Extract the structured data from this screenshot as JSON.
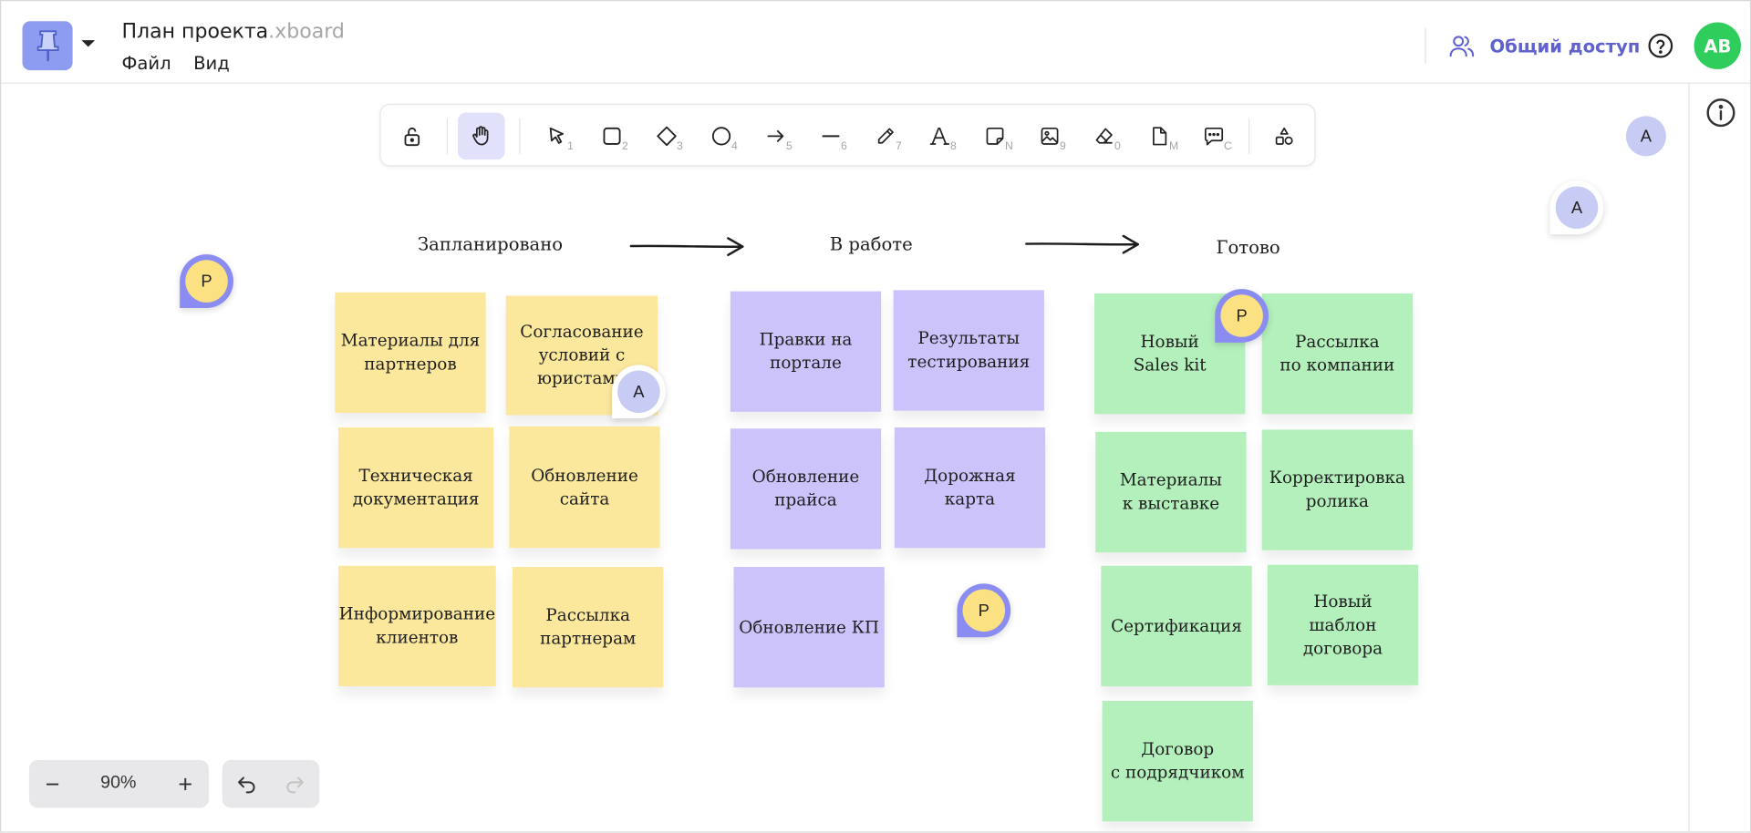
{
  "header": {
    "title": "План проекта",
    "title_ext": ".xboard",
    "menu": [
      "Файл",
      "Вид"
    ],
    "share_label": "Общий доступ",
    "user_initials": "AB",
    "accent_color": "#5f61cf",
    "avatar_color": "#2fce5c"
  },
  "toolbar": {
    "tools": [
      {
        "name": "lock",
        "hotkey": ""
      },
      {
        "name": "hand",
        "hotkey": "",
        "active": true
      },
      {
        "name": "select",
        "hotkey": "1"
      },
      {
        "name": "rectangle",
        "hotkey": "2"
      },
      {
        "name": "diamond",
        "hotkey": "3"
      },
      {
        "name": "ellipse",
        "hotkey": "4"
      },
      {
        "name": "arrow",
        "hotkey": "5"
      },
      {
        "name": "line",
        "hotkey": "6"
      },
      {
        "name": "pencil",
        "hotkey": "7"
      },
      {
        "name": "text",
        "hotkey": "8"
      },
      {
        "name": "sticky-note",
        "hotkey": "N"
      },
      {
        "name": "image",
        "hotkey": "9"
      },
      {
        "name": "eraser",
        "hotkey": "0"
      },
      {
        "name": "document",
        "hotkey": "M"
      },
      {
        "name": "comment",
        "hotkey": "C"
      },
      {
        "name": "shapes-library",
        "hotkey": ""
      }
    ]
  },
  "board": {
    "columns": [
      {
        "title": "Запланировано",
        "color": "#fbe89d",
        "notes": [
          "Материалы для\nпартнеров",
          "Согласование\nусловий с\nюристами",
          "Техническая\nдокументация",
          "Обновление\nсайта",
          "Информирование\nклиентов",
          "Рассылка\nпартнерам"
        ]
      },
      {
        "title": "В работе",
        "color": "#ccc3fb",
        "notes": [
          "Правки на\nпортале",
          "Результаты\nтестирования",
          "Обновление\nпрайса",
          "Дорожная\nкарта",
          "Обновление КП"
        ]
      },
      {
        "title": "Готово",
        "color": "#b3f0bb",
        "notes": [
          "Новый\nSales kit",
          "Рассылка\nпо компании",
          "Материалы\nк выставке",
          "Корректировка\nролика",
          "Сертификация",
          "Новый\nшаблон\nдоговора",
          "Договор\nс подрядчиком"
        ]
      }
    ],
    "comment_pins": [
      "P",
      "A",
      "P",
      "P",
      "A"
    ],
    "cursor_label": "A"
  },
  "zoom": {
    "minus": "−",
    "value": "90%",
    "plus": "+"
  }
}
